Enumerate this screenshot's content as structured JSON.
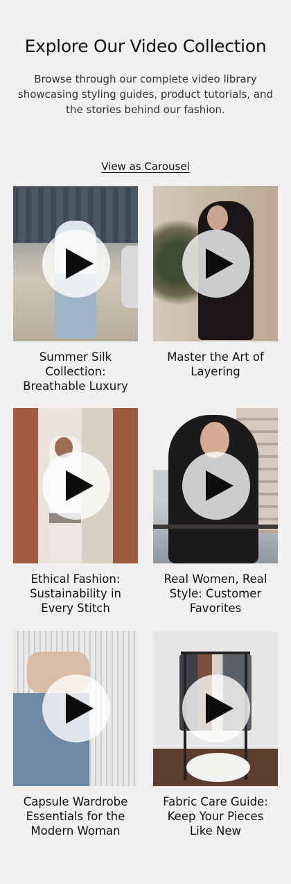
{
  "header": {
    "title": "Explore Our Video Collection",
    "subtitle": "Browse through our complete video library showcasing styling guides, product tutorials, and the stories behind our fashion.",
    "view_link": "View as Carousel"
  },
  "videos": [
    {
      "title": "Summer Silk Collection: Breathable Luxury",
      "icon": "play-icon"
    },
    {
      "title": "Master the Art of Layering",
      "icon": "play-icon"
    },
    {
      "title": "Ethical Fashion: Sustainability in Every Stitch",
      "icon": "play-icon"
    },
    {
      "title": "Real Women, Real Style: Customer Favorites",
      "icon": "play-icon"
    },
    {
      "title": "Capsule Wardrobe Essentials for the Modern Woman",
      "icon": "play-icon"
    },
    {
      "title": "Fabric Care Guide: Keep Your Pieces Like New",
      "icon": "play-icon"
    }
  ],
  "colors": {
    "background": "#f1f0ef",
    "text": "#111111",
    "play_button_bg": "#ffffff",
    "play_icon": "#0d0d0d"
  }
}
